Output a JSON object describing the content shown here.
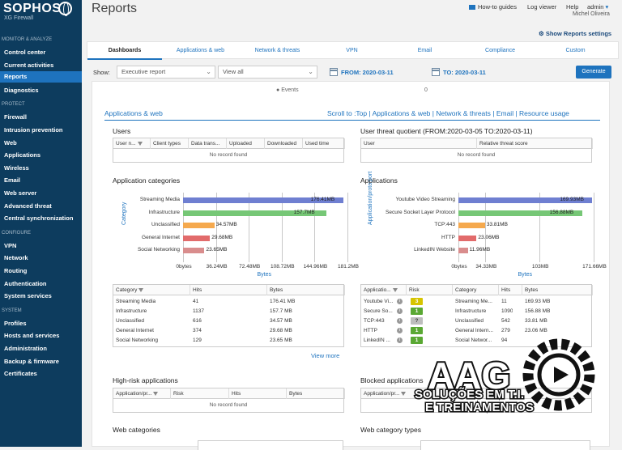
{
  "brand": {
    "name": "SOPHOS",
    "product": "XG Firewall"
  },
  "sidebar": {
    "sections": [
      {
        "label": "MONITOR & ANALYZE",
        "items": [
          "Control center",
          "Current activities",
          "Reports",
          "Diagnostics"
        ]
      },
      {
        "label": "PROTECT",
        "items": [
          "Firewall",
          "Intrusion prevention",
          "Web",
          "Applications",
          "Wireless",
          "Email",
          "Web server",
          "Advanced threat",
          "Central synchronization"
        ]
      },
      {
        "label": "CONFIGURE",
        "items": [
          "VPN",
          "Network",
          "Routing",
          "Authentication",
          "System services"
        ]
      },
      {
        "label": "SYSTEM",
        "items": [
          "Profiles",
          "Hosts and services",
          "Administration",
          "Backup & firmware",
          "Certificates"
        ]
      }
    ],
    "active": "Reports"
  },
  "header": {
    "title": "Reports",
    "howto": "How-to guides",
    "logviewer": "Log viewer",
    "help": "Help",
    "admin": "admin",
    "user": "Michel Oliveira",
    "show_settings": "Show Reports settings"
  },
  "tabs": [
    "Dashboards",
    "Applications & web",
    "Network & threats",
    "VPN",
    "Email",
    "Compliance",
    "Custom"
  ],
  "filters": {
    "show_label": "Show:",
    "report": "Executive report",
    "view": "View all",
    "from": "FROM: 2020-03-11",
    "to": "TO: 2020-03-11",
    "generate": "Generate"
  },
  "events": {
    "label": "Events",
    "value": "0"
  },
  "section": {
    "label": "Applications & web",
    "scroll": "Scroll to :Top | Applications & web | Network & threats | Email | Resource usage"
  },
  "users": {
    "title": "Users",
    "cols": [
      "User n...",
      "Client types",
      "Data trans...",
      "Uploaded",
      "Downloaded",
      "Used time"
    ],
    "empty": "No record found"
  },
  "threat": {
    "title": "User threat quotient (FROM:2020-03-05 TO:2020-03-11)",
    "cols": [
      "User",
      "Relative threat score"
    ],
    "empty": "No record found"
  },
  "appcat": {
    "title": "Application categories",
    "xlabel": "Bytes",
    "ylabel": "Category",
    "ticks": [
      "0bytes",
      "36.24MB",
      "72.48MB",
      "108.72MB",
      "144.96MB",
      "181.2MB"
    ]
  },
  "apps": {
    "title": "Applications",
    "xlabel": "Bytes",
    "ylabel": "Application/proto:port",
    "ticks": [
      "0bytes",
      "34.33MB",
      "103MB",
      "171.66MB"
    ]
  },
  "chart_data": [
    {
      "type": "bar",
      "title": "Application categories",
      "xlabel": "Bytes",
      "ylabel": "Category",
      "categories": [
        "Streaming Media",
        "Infrastructure",
        "Unclassified",
        "General Internet",
        "Social Networking"
      ],
      "values": [
        176.41,
        157.7,
        34.57,
        29.68,
        23.65
      ],
      "labels": [
        "176.41MB",
        "157.7MB",
        "34.57MB",
        "29.68MB",
        "23.65MB"
      ],
      "colors": [
        "#6f7fd1",
        "#76c776",
        "#f5a94e",
        "#e26b6b",
        "#d98d8d"
      ],
      "xlim": [
        0,
        181.2
      ]
    },
    {
      "type": "bar",
      "title": "Applications",
      "xlabel": "Bytes",
      "ylabel": "Application/proto:port",
      "categories": [
        "Youtube Video Streaming",
        "Secure Socket Layer Protocol",
        "TCP:443",
        "HTTP",
        "LinkedIN Website"
      ],
      "values": [
        169.93,
        156.88,
        33.81,
        23.06,
        11.96
      ],
      "labels": [
        "169.93MB",
        "156.88MB",
        "33.81MB",
        "23.06MB",
        "11.96MB"
      ],
      "colors": [
        "#6f7fd1",
        "#76c776",
        "#f5a94e",
        "#e26b6b",
        "#d98d8d"
      ],
      "xlim": [
        0,
        171.66
      ]
    }
  ],
  "cattable": {
    "cols": [
      "Category",
      "Hits",
      "Bytes"
    ],
    "rows": [
      [
        "Streaming Media",
        "41",
        "176.41 MB"
      ],
      [
        "Infrastructure",
        "1137",
        "157.7 MB"
      ],
      [
        "Unclassified",
        "616",
        "34.57 MB"
      ],
      [
        "General Internet",
        "374",
        "29.68 MB"
      ],
      [
        "Social Networking",
        "129",
        "23.65 MB"
      ]
    ],
    "viewmore": "View more"
  },
  "apptable": {
    "cols": [
      "Applicatio...",
      "Risk",
      "Category",
      "Hits",
      "Bytes"
    ],
    "rows": [
      [
        "Youtube Vi...",
        "3",
        "Streaming Me...",
        "11",
        "169.93 MB"
      ],
      [
        "Secure So...",
        "1",
        "Infrastructure",
        "1090",
        "156.88 MB"
      ],
      [
        "TCP:443",
        "?",
        "Unclassified",
        "542",
        "33.81 MB"
      ],
      [
        "HTTP",
        "1",
        "General Intern...",
        "279",
        "23.06 MB"
      ],
      [
        "LinkedIN ...",
        "1",
        "Social Networ...",
        "94",
        ""
      ]
    ],
    "risk_colors": [
      "#d6c400",
      "#5aa833",
      "#bdbdbd",
      "#5aa833",
      "#5aa833"
    ]
  },
  "highrisk": {
    "title": "High-risk applications",
    "cols": [
      "Application/pr...",
      "Risk",
      "Hits",
      "Bytes"
    ],
    "empty": "No record found"
  },
  "blocked": {
    "title": "Blocked applications",
    "cols": [
      "Application/pr..."
    ]
  },
  "webcat": {
    "title": "Web categories"
  },
  "webcattypes": {
    "title": "Web category types"
  },
  "watermark": {
    "line1": "AAG",
    "line2": "SOLUÇÕES EM T.I.",
    "line3": "E TREINAMENTOS"
  }
}
